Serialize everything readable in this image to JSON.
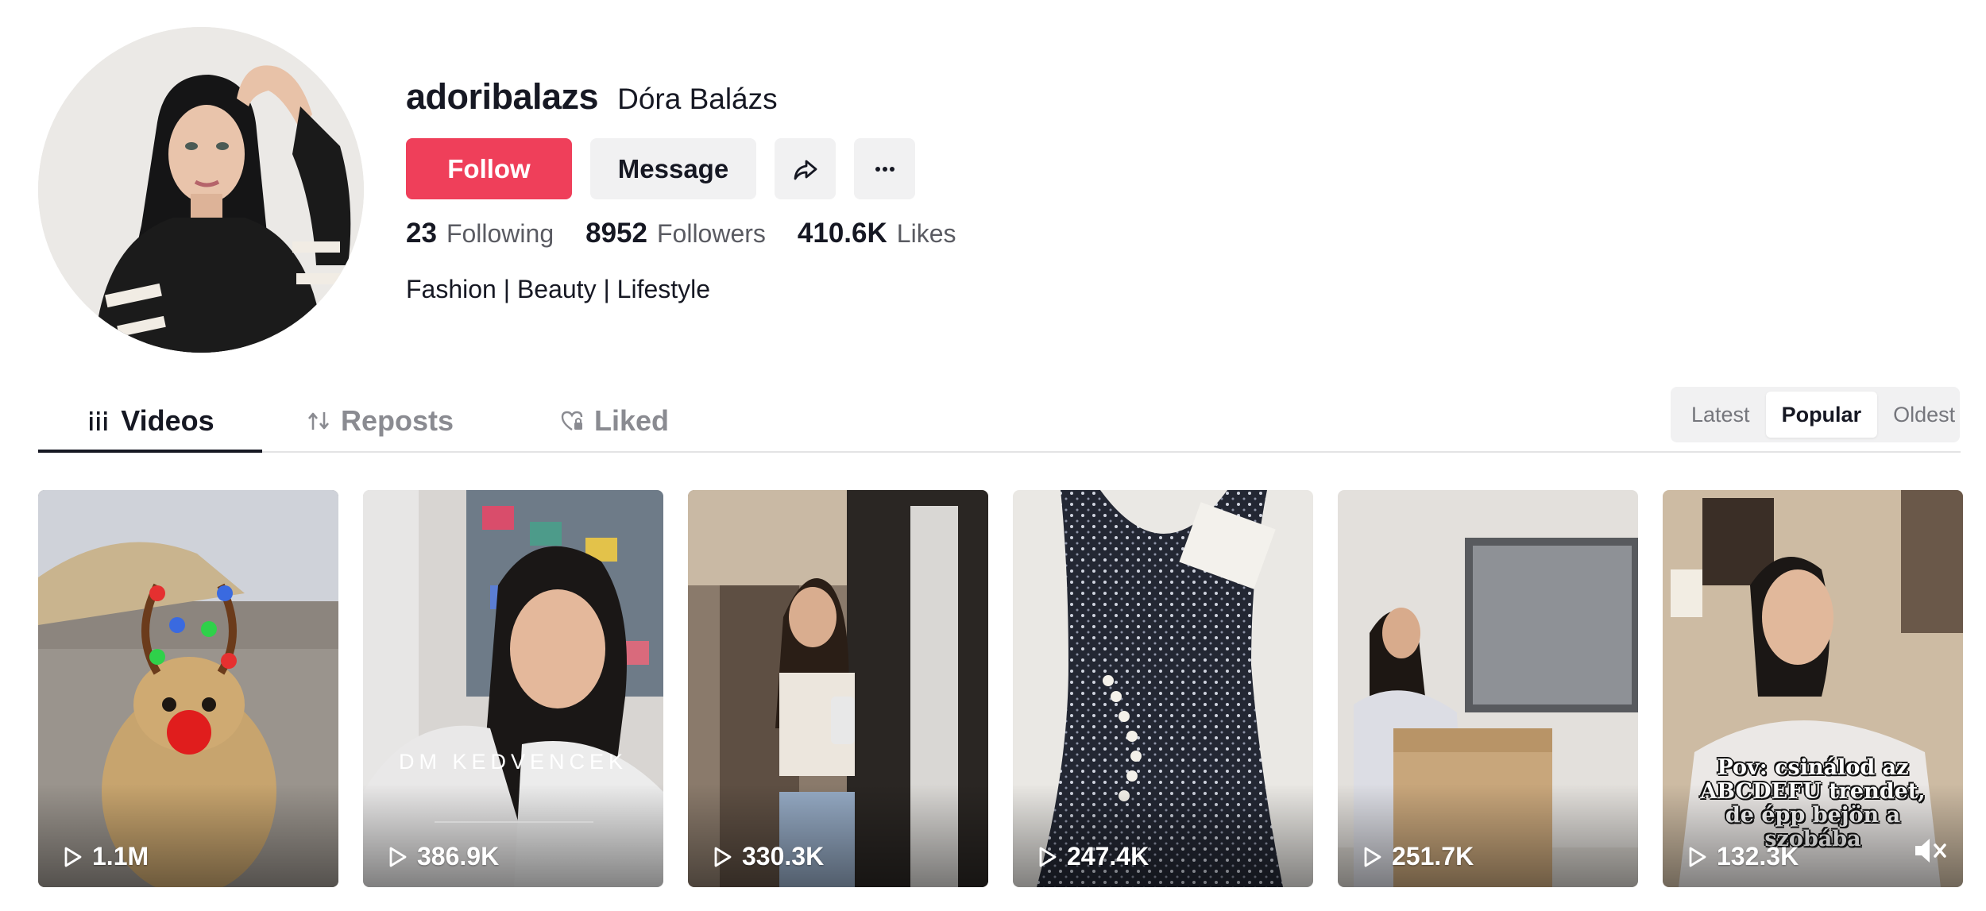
{
  "profile": {
    "username": "adoribalazs",
    "nickname": "Dóra Balázs",
    "bio": "Fashion | Beauty | Lifestyle",
    "avatar_icon": "avatar-photo"
  },
  "actions": {
    "follow_label": "Follow",
    "message_label": "Message",
    "share_icon": "share-icon",
    "more_icon": "more-icon"
  },
  "stats": {
    "following_count": "23",
    "following_label": "Following",
    "followers_count": "8952",
    "followers_label": "Followers",
    "likes_count": "410.6K",
    "likes_label": "Likes"
  },
  "tabs": [
    {
      "label": "Videos",
      "icon": "grid-icon",
      "active": true
    },
    {
      "label": "Reposts",
      "icon": "repost-icon",
      "active": false
    },
    {
      "label": "Liked",
      "icon": "heart-lock-icon",
      "active": false
    }
  ],
  "sort": {
    "options": [
      "Latest",
      "Popular",
      "Oldest"
    ],
    "selected": "Popular"
  },
  "videos": [
    {
      "views": "1.1M"
    },
    {
      "views": "386.9K",
      "overlay": "DM KEDVENCEK"
    },
    {
      "views": "330.3K"
    },
    {
      "views": "247.4K"
    },
    {
      "views": "251.7K"
    },
    {
      "views": "132.3K",
      "overlay": "Pov: csinálod az ABCDEFU trendet, de épp bejön a szobába"
    }
  ],
  "colors": {
    "accent": "#ef3f5a",
    "text": "#161823",
    "muted": "#5a5b62",
    "button_bg": "#f1f1f2"
  }
}
